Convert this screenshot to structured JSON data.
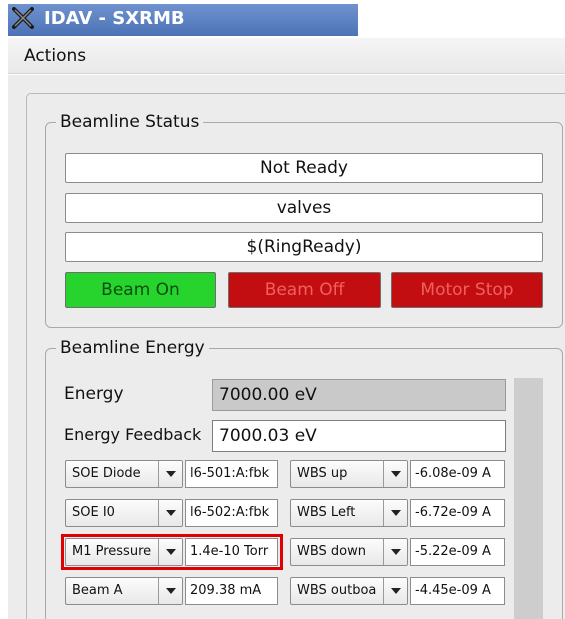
{
  "window": {
    "title": "IDAV - SXRMB"
  },
  "menu": {
    "actions_label": "Actions"
  },
  "beamline_status": {
    "title": "Beamline Status",
    "fields": [
      "Not Ready",
      "valves",
      "$(RingReady)"
    ],
    "buttons": {
      "beam_on": "Beam On",
      "beam_off": "Beam Off",
      "motor_stop": "Motor Stop"
    }
  },
  "beamline_energy": {
    "title": "Beamline Energy",
    "energy_label": "Energy",
    "energy_value": "7000.00 eV",
    "feedback_label": "Energy Feedback",
    "feedback_value": "7000.03 eV"
  },
  "detectors": {
    "left": [
      {
        "name": "SOE Diode",
        "value": "l6-501:A:fbk"
      },
      {
        "name": "SOE I0",
        "value": "l6-502:A:fbk"
      },
      {
        "name": "M1 Pressure",
        "value": "1.4e-10 Torr"
      },
      {
        "name": "Beam A",
        "value": "209.38 mA"
      }
    ],
    "right": [
      {
        "name": "WBS up",
        "value": "-6.08e-09 A"
      },
      {
        "name": "WBS Left",
        "value": "-6.72e-09 A"
      },
      {
        "name": "WBS down",
        "value": "-5.22e-09 A"
      },
      {
        "name": "WBS outboa",
        "value": "-4.45e-09 A"
      }
    ]
  },
  "colors": {
    "title_bar": "#5a7fc1",
    "beam_on": "#27d42e",
    "beam_off": "#c20e10",
    "motor_stop": "#c20e10",
    "highlight": "#e00000"
  }
}
